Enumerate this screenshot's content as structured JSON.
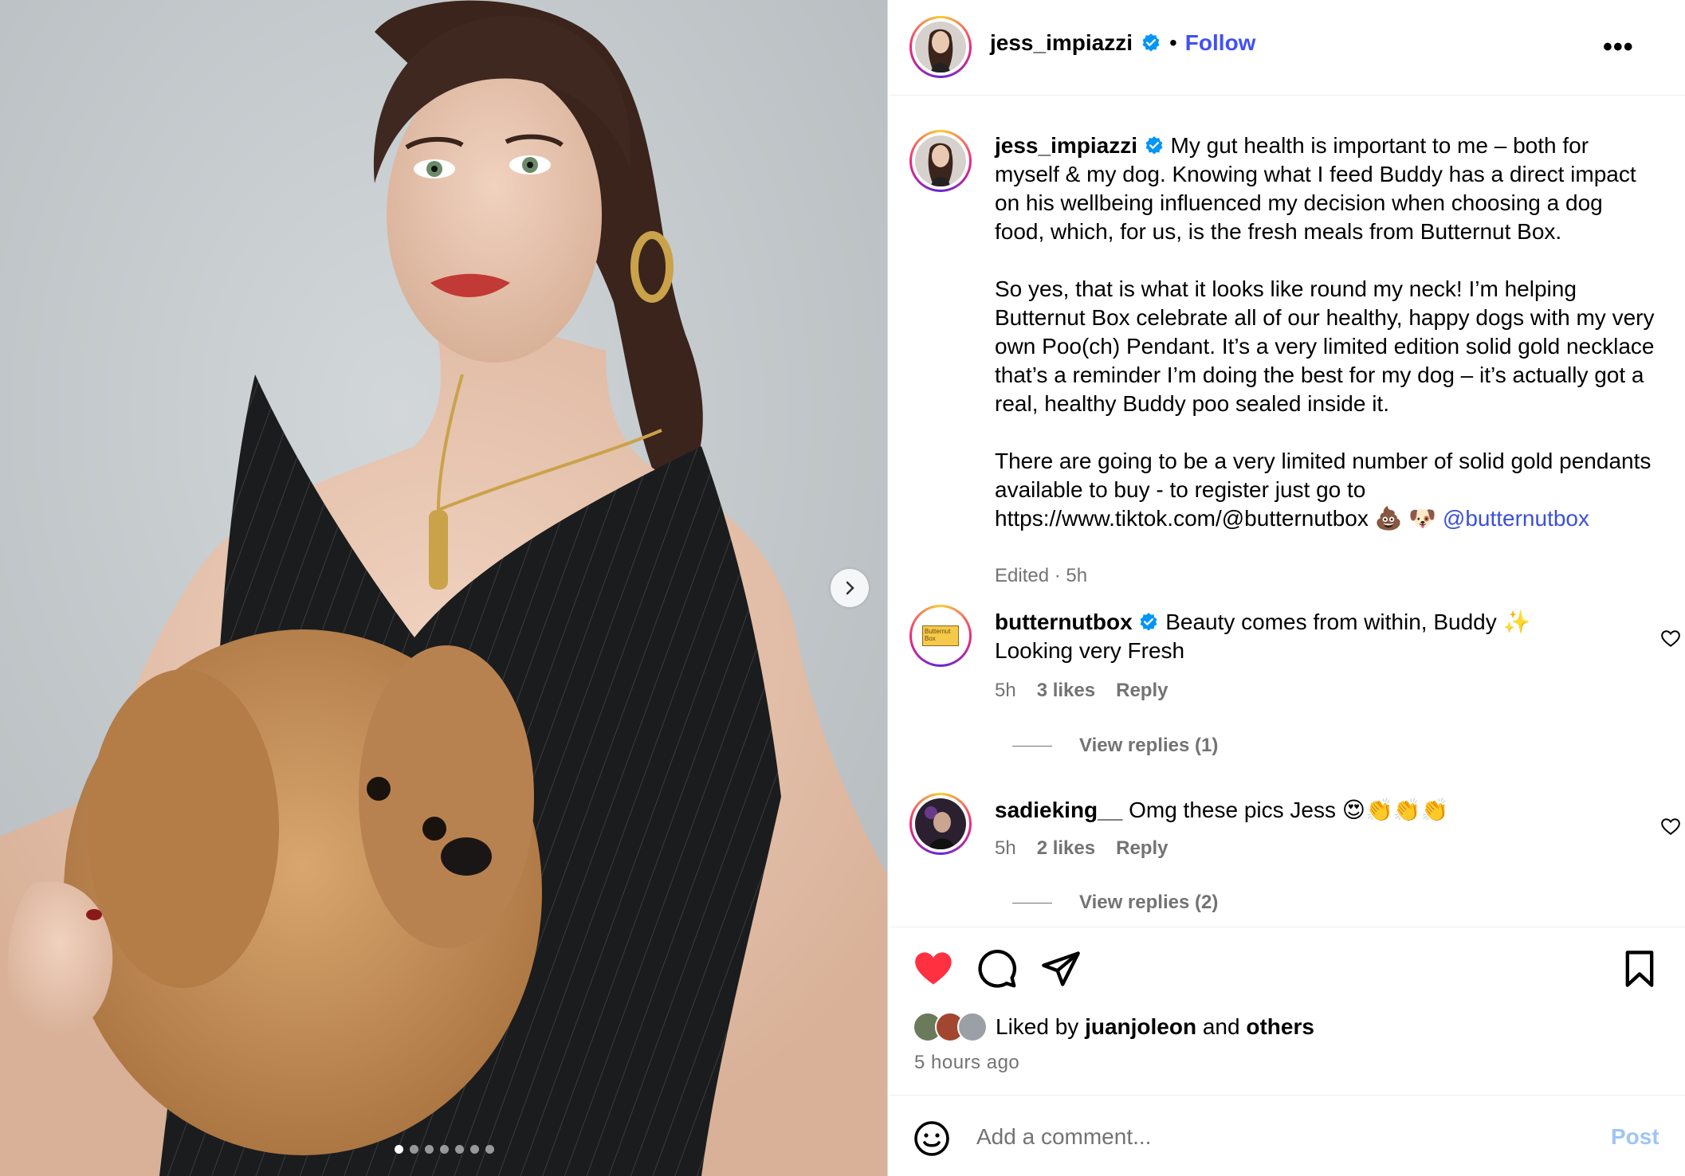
{
  "post": {
    "username": "jess_impiazzi",
    "follow_label": "Follow",
    "separator": "•",
    "more_label": "•••",
    "image_count": 7,
    "image_active_index": 0
  },
  "caption": {
    "username": "jess_impiazzi",
    "paragraph_1": "My gut health is important to me  – both for myself & my dog. Knowing what I feed Buddy has a direct impact on his wellbeing influenced my decision when choosing a dog food, which, for us, is the fresh meals from Butternut Box.",
    "paragraph_2": "So yes, that is what it looks like round my neck! I’m helping Butternut Box celebrate all of our healthy, happy dogs with my very own Poo(ch) Pendant. It’s a very limited edition solid gold necklace that’s a reminder I’m doing the best for my dog – it’s actually got a real, healthy Buddy poo sealed inside it.",
    "paragraph_3_text": "There are going to be a very limited number of solid gold pendants available to buy - to register just go to https://www.tiktok.com/@butternutbox 💩 🐶 ",
    "paragraph_3_mention": "@butternutbox",
    "meta": "Edited · 5h"
  },
  "comments": [
    {
      "username": "butternutbox",
      "text": "Beauty comes from within, Buddy ✨ Looking very Fresh",
      "time": "5h",
      "likes": "3 likes",
      "reply_label": "Reply",
      "view_replies": "View replies (1)",
      "avatar_text": "Butternut Box"
    },
    {
      "username": "sadieking__",
      "text": "Omg these pics Jess 😍👏👏👏",
      "time": "5h",
      "likes": "2 likes",
      "reply_label": "Reply",
      "view_replies": "View replies (2)"
    }
  ],
  "engagement": {
    "liked_by_prefix": "Liked by ",
    "liked_by_user": "juanjoleon",
    "liked_by_mid": " and ",
    "liked_by_others": "others",
    "time_ago": "5 hours ago",
    "liked": true
  },
  "composer": {
    "placeholder": "Add a comment...",
    "post_label": "Post"
  },
  "icons": {
    "verified": "verified-badge-icon",
    "heart": "heart-icon",
    "comment": "comment-icon",
    "share": "share-icon",
    "save": "bookmark-icon",
    "emoji": "emoji-icon",
    "next": "chevron-right-icon",
    "more": "more-icon"
  },
  "colors": {
    "accent_blue": "#0095f6",
    "heart_red": "#ff3040",
    "verified_blue": "#0095f6",
    "muted_text": "#737373"
  }
}
